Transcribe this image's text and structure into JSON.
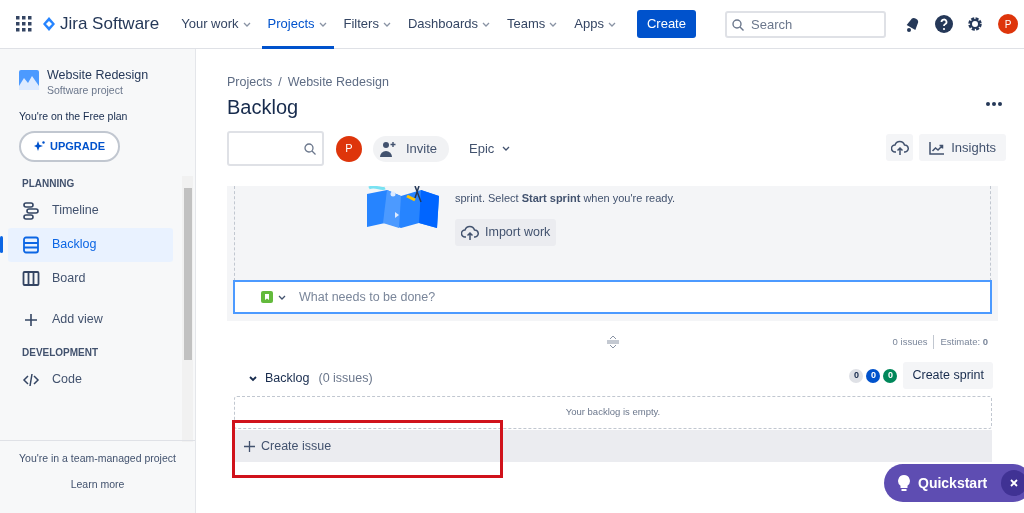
{
  "top_nav": {
    "product": "Jira Software",
    "menus": [
      {
        "label": "Your work",
        "selected": false
      },
      {
        "label": "Projects",
        "selected": true
      },
      {
        "label": "Filters",
        "selected": false
      },
      {
        "label": "Dashboards",
        "selected": false
      },
      {
        "label": "Teams",
        "selected": false
      },
      {
        "label": "Apps",
        "selected": false
      }
    ],
    "create_button": "Create",
    "search": {
      "placeholder": "Search"
    },
    "avatar": "P"
  },
  "sidebar": {
    "project": {
      "name": "Website Redesign",
      "type": "Software project"
    },
    "plan_note": "You're on the Free plan",
    "upgrade_button": "UPGRADE",
    "sections": [
      {
        "heading": "PLANNING",
        "items": [
          {
            "label": "Timeline",
            "kind": "timeline",
            "selected": false
          },
          {
            "label": "Backlog",
            "kind": "backlog",
            "selected": true
          },
          {
            "label": "Board",
            "kind": "board",
            "selected": false
          },
          {
            "label": "Add view",
            "kind": "add",
            "selected": false
          }
        ]
      },
      {
        "heading": "DEVELOPMENT",
        "items": [
          {
            "label": "Code",
            "kind": "code",
            "selected": false
          }
        ]
      }
    ],
    "footer": {
      "note": "You're in a team-managed project",
      "link": "Learn more"
    }
  },
  "main": {
    "breadcrumb": [
      "Projects",
      "/",
      "Website Redesign"
    ],
    "title": "Backlog",
    "toolbar": {
      "avatar": "P",
      "invite": "Invite",
      "epic": "Epic",
      "insights": "Insights"
    },
    "sprint_panel": {
      "message": "sprint. Select **Start sprint** when you're ready.",
      "import_button": "Import work",
      "input_placeholder": "What needs to be done?"
    },
    "summary": {
      "issues": "0 issues",
      "estimate": "Estimate: **0**"
    },
    "backlog": {
      "title": "Backlog",
      "count": "(0 issues)",
      "badges": [
        {
          "text": "0",
          "color": "#dfe1e6"
        },
        {
          "text": "0",
          "color": "#0052cc"
        },
        {
          "text": "0",
          "color": "#00875a"
        }
      ],
      "create_sprint": "Create sprint",
      "empty_message": "Your backlog is empty.",
      "create_issue": {
        "label": "Create issue",
        "highlighted": true
      }
    }
  },
  "quickstart": {
    "label": "Quickstart"
  }
}
